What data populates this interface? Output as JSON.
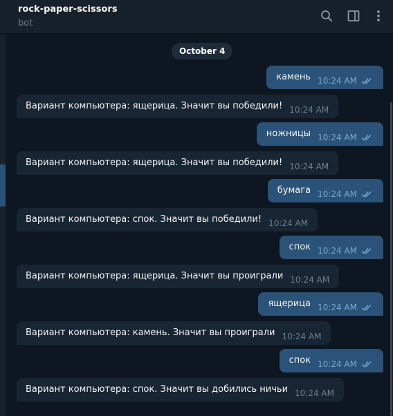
{
  "header": {
    "title": "rock-paper-scissors",
    "subtitle": "bot",
    "icons": {
      "search": "search-icon",
      "sidebar": "sidebar-toggle-icon",
      "more": "more-vertical-icon"
    }
  },
  "date_separator": "October 4",
  "colors": {
    "background": "#0e1621",
    "header": "#17212b",
    "outgoing_bubble": "#2b5278",
    "incoming_bubble": "#182533",
    "time_outgoing": "#7da8d3",
    "time_incoming": "#6d7f8f"
  },
  "messages": [
    {
      "dir": "out",
      "text": "камень",
      "time": "10:24 AM",
      "read": true
    },
    {
      "dir": "in",
      "text": "Вариант компьютера: ящерица. Значит вы победили!",
      "time": "10:24 AM"
    },
    {
      "dir": "out",
      "text": "ножницы",
      "time": "10:24 AM",
      "read": true
    },
    {
      "dir": "in",
      "text": "Вариант компьютера: ящерица. Значит вы победили!",
      "time": "10:24 AM"
    },
    {
      "dir": "out",
      "text": "бумага",
      "time": "10:24 AM",
      "read": true
    },
    {
      "dir": "in",
      "text": "Вариант компьютера: спок. Значит вы победили!",
      "time": "10:24 AM"
    },
    {
      "dir": "out",
      "text": "спок",
      "time": "10:24 AM",
      "read": true
    },
    {
      "dir": "in",
      "text": "Вариант компьютера: ящерица. Значит вы проиграли",
      "time": "10:24 AM"
    },
    {
      "dir": "out",
      "text": "ящерица",
      "time": "10:24 AM",
      "read": true
    },
    {
      "dir": "in",
      "text": "Вариант компьютера: камень. Значит вы проиграли",
      "time": "10:24 AM"
    },
    {
      "dir": "out",
      "text": "спок",
      "time": "10:24 AM",
      "read": true
    },
    {
      "dir": "in",
      "text": "Вариант компьютера: спок. Значит вы добились ничьи",
      "time": "10:24 AM"
    }
  ]
}
